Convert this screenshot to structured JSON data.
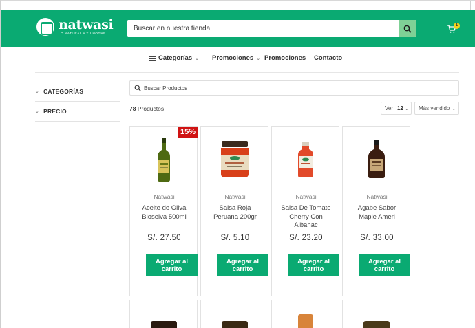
{
  "colors": {
    "brand_green": "#0aaa72",
    "search_button": "#7fd196",
    "discount_red": "#d01313",
    "cart_badge": "#f2d21b"
  },
  "header": {
    "logo_name": "natwasi",
    "logo_tagline": "LO NATURAL A TU HOGAR",
    "search_placeholder": "Buscar en nuestra tienda",
    "cart_count": "1",
    "icons": [
      "logo-icon",
      "search-icon",
      "cart-icon"
    ]
  },
  "nav": {
    "items": [
      {
        "label": "Categorías",
        "has_dropdown": true,
        "icon": "hamburger-icon"
      },
      {
        "label": "Promociones",
        "has_dropdown": true
      },
      {
        "label": "Promociones",
        "has_dropdown": false
      },
      {
        "label": "Contacto",
        "has_dropdown": false
      }
    ]
  },
  "sidebar": {
    "filters": [
      {
        "label": "CATEGORÍAS"
      },
      {
        "label": "PRECIO"
      }
    ]
  },
  "toolbar": {
    "product_search_placeholder": "Buscar Productos",
    "count_number": "78",
    "count_label": "Productos",
    "view_label": "Ver",
    "view_value": "12",
    "sort_value": "Más vendido"
  },
  "products": [
    {
      "brand": "Natwasi",
      "title": "Aceite de Oliva Bioselva 500ml",
      "price": "S/. 27.50",
      "badge": "15%",
      "button": "Agregar al carrito"
    },
    {
      "brand": "Natwasi",
      "title": "Salsa Roja Peruana 200gr",
      "price": "S/. 5.10",
      "button": "Agregar al carrito"
    },
    {
      "brand": "Natwasi",
      "title": "Salsa De Tomate Cherry Con Albahac",
      "price": "S/. 23.20",
      "button": "Agregar al carrito"
    },
    {
      "brand": "Natwasi",
      "title": "Agabe Sabor Maple Ameri",
      "price": "S/. 33.00",
      "button": "Agregar al carrito"
    }
  ]
}
